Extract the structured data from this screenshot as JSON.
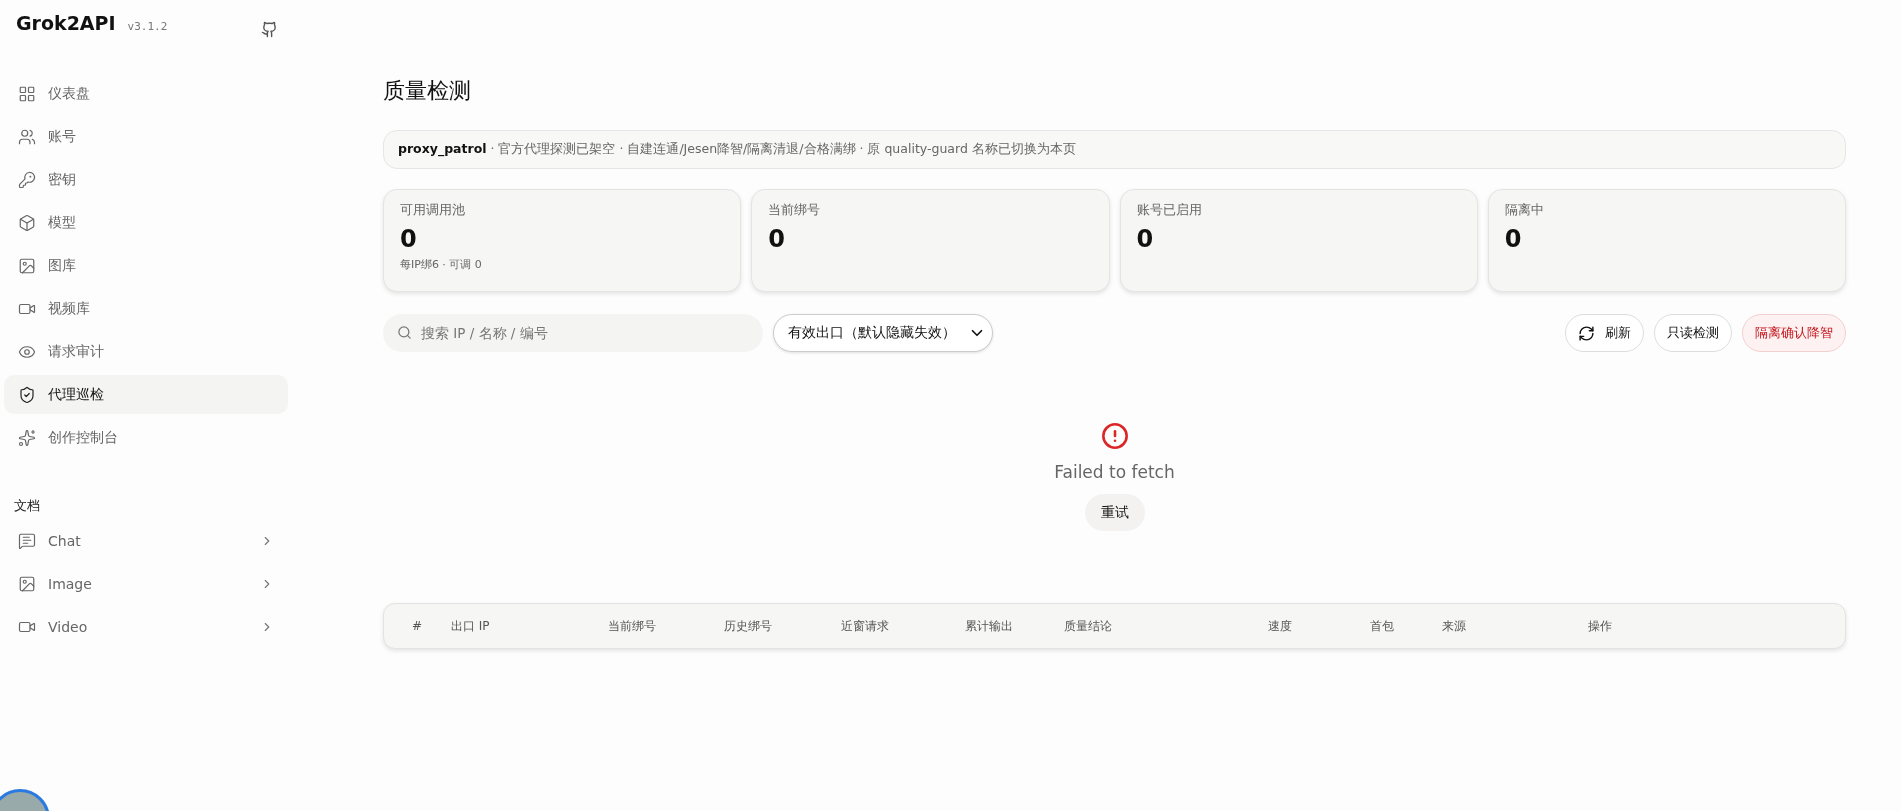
{
  "brand": {
    "name": "Grok2API",
    "version": "v3.1.2"
  },
  "sidebar": {
    "items": [
      {
        "label": "仪表盘",
        "selected": false
      },
      {
        "label": "账号",
        "selected": false
      },
      {
        "label": "密钥",
        "selected": false
      },
      {
        "label": "模型",
        "selected": false
      },
      {
        "label": "图库",
        "selected": false
      },
      {
        "label": "视频库",
        "selected": false
      },
      {
        "label": "请求审计",
        "selected": false
      },
      {
        "label": "代理巡检",
        "selected": true
      },
      {
        "label": "创作控制台",
        "selected": false
      }
    ],
    "docs_heading": "文档",
    "docs": [
      {
        "label": "Chat",
        "expanded": false
      },
      {
        "label": "Image",
        "expanded": false
      },
      {
        "label": "Video",
        "expanded": false
      }
    ]
  },
  "page": {
    "title": "质量检测",
    "notice": "**proxy_patrol** · 官方代理探测已架空 · 自建连通/Jesen降智/隔离清退/合格满绑 · 原 quality-guard 名称已切换为本页",
    "stats": [
      {
        "label": "可用调用池",
        "value": "0",
        "note": "每IP绑6 · 可调 0"
      },
      {
        "label": "当前绑号",
        "value": "0"
      },
      {
        "label": "账号已启用",
        "value": "0"
      },
      {
        "label": "隔离中",
        "value": "0"
      }
    ],
    "search": {
      "placeholder": "搜索 IP / 名称 / 编号"
    },
    "filter": {
      "value": "有效出口（默认隐藏失效）"
    },
    "buttons": [
      {
        "label": "刷新",
        "kind": "refresh"
      },
      {
        "label": "只读检测",
        "kind": "plain"
      },
      {
        "label": "隔离确认降智",
        "kind": "danger"
      }
    ],
    "error": {
      "message": "Failed to fetch",
      "retry": "重试"
    },
    "table": {
      "columns": [
        "#",
        "出口 IP",
        "当前绑号",
        "历史绑号",
        "近窗请求",
        "累计输出",
        "质量结论",
        "速度",
        "首包",
        "来源",
        "操作"
      ]
    }
  }
}
